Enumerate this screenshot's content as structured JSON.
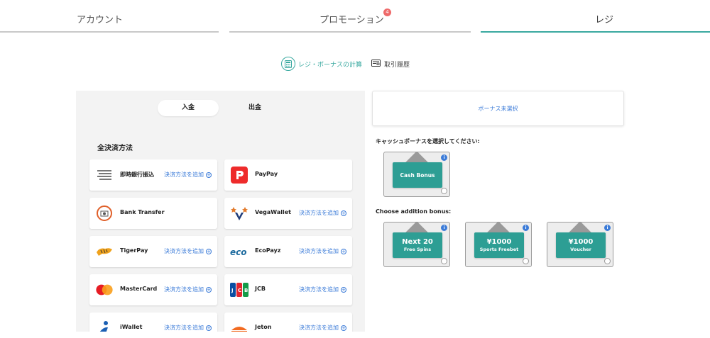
{
  "tabs": [
    {
      "label": "アカウント"
    },
    {
      "label": "プロモーション",
      "badge": "4"
    },
    {
      "label": "レジ"
    }
  ],
  "sublinks": {
    "calc": "レジ・ボーナスの計算",
    "history": "取引履歴"
  },
  "left": {
    "toggle": {
      "deposit": "入金",
      "withdraw": "出金"
    },
    "section_title": "全決済方法",
    "methods": [
      {
        "name": "即時銀行振込",
        "add": "決済方法を追加",
        "icon": "bank-lines-icon"
      },
      {
        "name": "PayPay",
        "add": "",
        "icon": "paypay-icon"
      },
      {
        "name": "Bank Transfer",
        "add": "",
        "icon": "bank-transfer-icon"
      },
      {
        "name": "VegaWallet",
        "add": "決済方法を追加",
        "icon": "vegawallet-icon"
      },
      {
        "name": "TigerPay",
        "add": "決済方法を追加",
        "icon": "tigerpay-icon"
      },
      {
        "name": "EcoPayz",
        "add": "決済方法を追加",
        "icon": "ecopayz-icon"
      },
      {
        "name": "MasterCard",
        "add": "決済方法を追加",
        "icon": "mastercard-icon"
      },
      {
        "name": "JCB",
        "add": "決済方法を追加",
        "icon": "jcb-icon"
      },
      {
        "name": "iWallet",
        "add": "決済方法を追加",
        "icon": "iwallet-icon"
      },
      {
        "name": "Jeton",
        "add": "決済方法を追加",
        "icon": "jeton-icon"
      }
    ]
  },
  "right": {
    "no_bonus": "ボーナス未選択",
    "cash_heading": "キャッシュボーナスを選択してください:",
    "addition_heading": "Choose addition bonus:",
    "cash_bonus": {
      "title": "Cash Bonus"
    },
    "addition_bonuses": [
      {
        "big": "Next 20",
        "small": "Free Spins"
      },
      {
        "big": "¥1000",
        "small": "Sports Freebet"
      },
      {
        "big": "¥1000",
        "small": "Voucher"
      }
    ]
  },
  "colors": {
    "accent": "#3aa9a0",
    "link": "#3b7bd8",
    "ticket": "#2d9e94"
  }
}
